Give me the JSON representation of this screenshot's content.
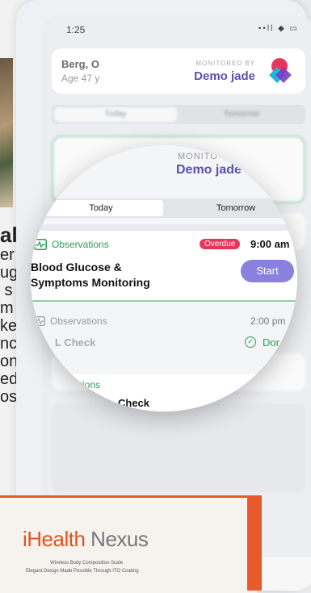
{
  "status_bar": {
    "time": "1:25",
    "icons": "••ll ◆ ▭"
  },
  "header": {
    "patient_name": "Berg, O",
    "patient_age": "Age 47 y",
    "monitored_by_label": "MONITORED BY",
    "monitor_name": "Demo jade"
  },
  "tabs": {
    "today": "Today",
    "tomorrow": "Tomorrow"
  },
  "magnifier": {
    "monitored_by_label": "MONITO",
    "monitor_name": "Demo jade",
    "tab_today": "Today",
    "tab_tomorrow": "Tomorrow",
    "task1": {
      "category": "Observations",
      "status": "Overdue",
      "time": "9:00 am",
      "title": "Blood Glucose & Symptoms Monitoring",
      "action": "Start"
    },
    "task2": {
      "category": "Observations",
      "time": "2:00 pm",
      "title": "L Check",
      "status": "Dor"
    },
    "task3": {
      "category": "vations",
      "title": "Check"
    }
  },
  "product_box": {
    "brand": "iHealth",
    "model": "Nexus",
    "tagline1": "Wireless Body Composition Scale",
    "tagline2": "Elegant Design Made Possible Through ITO Coating"
  },
  "colors": {
    "accent": "#5d4fb3",
    "success": "#2e9b57",
    "overdue": "#e8365b",
    "button": "#8a80dd",
    "brand": "#e3531f"
  }
}
